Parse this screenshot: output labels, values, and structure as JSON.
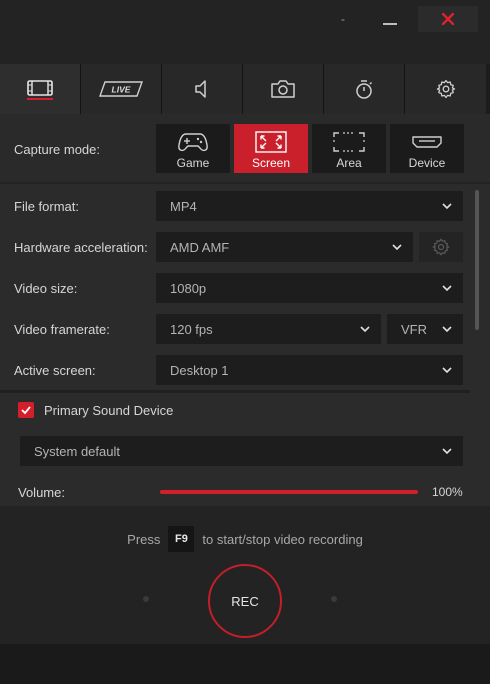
{
  "window": {
    "buttons": {
      "dash": "-",
      "minimize": "minimize",
      "close": "close"
    }
  },
  "tabs": [
    {
      "icon": "film-icon",
      "label": "",
      "active": true
    },
    {
      "icon": "live-icon",
      "label": "LIVE",
      "active": false
    },
    {
      "icon": "speaker-icon",
      "label": "",
      "active": false
    },
    {
      "icon": "camera-icon",
      "label": "",
      "active": false
    },
    {
      "icon": "timer-icon",
      "label": "",
      "active": false
    },
    {
      "icon": "gear-icon",
      "label": "",
      "active": false
    }
  ],
  "capture": {
    "label": "Capture mode:",
    "modes": [
      {
        "label": "Game",
        "icon": "gamepad-icon",
        "active": false
      },
      {
        "label": "Screen",
        "icon": "fullscreen-icon",
        "active": true
      },
      {
        "label": "Area",
        "icon": "area-select-icon",
        "active": false
      },
      {
        "label": "Device",
        "icon": "hdmi-icon",
        "active": false
      }
    ]
  },
  "settings": {
    "file_format": {
      "label": "File format:",
      "value": "MP4"
    },
    "hw_accel": {
      "label": "Hardware acceleration:",
      "value": "AMD AMF"
    },
    "video_size": {
      "label": "Video size:",
      "value": "1080p"
    },
    "framerate": {
      "label": "Video framerate:",
      "value": "120 fps",
      "mode": "VFR"
    },
    "active_screen": {
      "label": "Active screen:",
      "value": "Desktop 1"
    }
  },
  "audio": {
    "device_label": "Primary Sound Device",
    "device_checked": true,
    "device_select": "System default",
    "volume_label": "Volume:",
    "volume_value": "100%",
    "volume_fraction": 1.0
  },
  "bottom": {
    "hint_prefix": "Press",
    "hotkey": "F9",
    "hint_suffix": "to start/stop video recording",
    "rec_label": "REC"
  },
  "colors": {
    "accent": "#d21f2b",
    "bg": "#232323",
    "panel": "#2b2b2b",
    "field": "#1d1d1d"
  }
}
